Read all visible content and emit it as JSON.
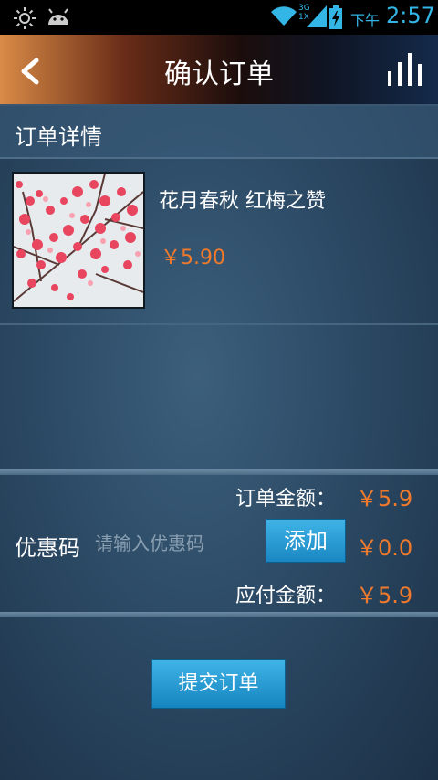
{
  "status_bar": {
    "network": "3G\n1X",
    "ampm": "下午",
    "time": "2:57"
  },
  "header": {
    "title": "确认订单"
  },
  "order_section": {
    "title": "订单详情"
  },
  "product": {
    "name": "花月春秋 红梅之赞",
    "price": "￥5.90"
  },
  "summary": {
    "order_amount_label": "订单金额：",
    "order_amount_value": "￥5.9",
    "coupon_label": "优惠码",
    "coupon_placeholder": "请输入优惠码",
    "add_button": "添加",
    "discount_value": "￥0.0",
    "payable_label": "应付金额：",
    "payable_value": "￥5.9"
  },
  "submit_button": "提交订单",
  "colors": {
    "accent_blue": "#33b5e5",
    "price_orange": "#f07a2c",
    "button_blue": "#2a9ad3"
  }
}
